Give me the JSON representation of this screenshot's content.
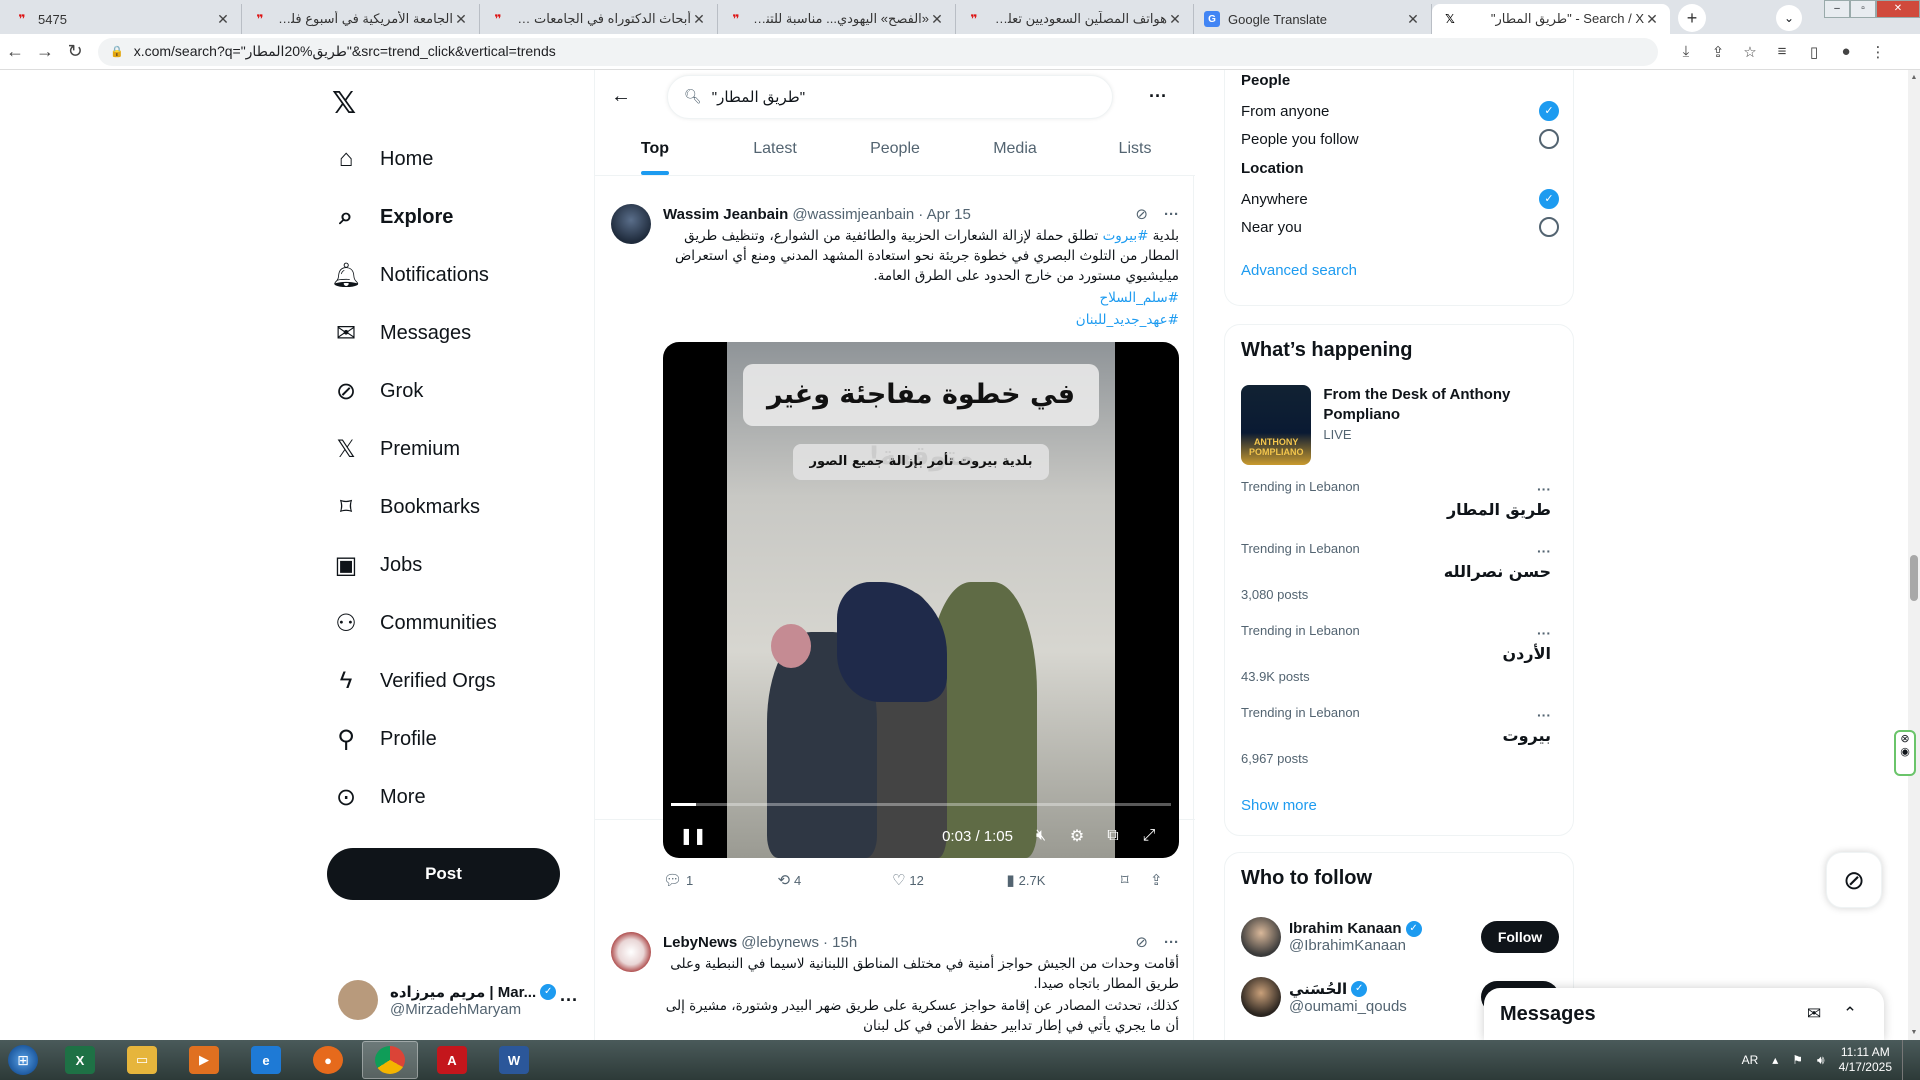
{
  "browser": {
    "tabs": [
      {
        "title": "5475",
        "icon": "red-quote-icon",
        "active": false
      },
      {
        "title": "الجامعة الأمريكية في أسبوع فلسطين: معنوي",
        "icon": "red-quote-icon",
        "active": false
      },
      {
        "title": "أبحاث الدكتوراه في الجامعات الخاصة: من يُ",
        "icon": "red-quote-icon",
        "active": false
      },
      {
        "title": "«الفصح» اليهودي... مناسبة للتنكيل بالفلسط",
        "icon": "red-quote-icon",
        "active": false
      },
      {
        "title": "هواتف المصلّين السعوديين تعلن ولادة المقاو",
        "icon": "red-quote-icon",
        "active": false
      },
      {
        "title": "Google Translate",
        "icon": "google-translate-icon",
        "active": false
      },
      {
        "title": "\"طريق المطار\" - Search / X",
        "icon": "x-logo-icon",
        "active": true
      }
    ],
    "url": "x.com/search?q=\"طريق%20المطار\"&src=trend_click&vertical=trends"
  },
  "nav": {
    "items": [
      {
        "label": "Home",
        "icon": "home-icon"
      },
      {
        "label": "Explore",
        "icon": "search-icon",
        "bold": true
      },
      {
        "label": "Notifications",
        "icon": "bell-icon"
      },
      {
        "label": "Messages",
        "icon": "mail-icon"
      },
      {
        "label": "Grok",
        "icon": "grok-icon"
      },
      {
        "label": "Premium",
        "icon": "x-logo-icon"
      },
      {
        "label": "Bookmarks",
        "icon": "bookmark-icon"
      },
      {
        "label": "Jobs",
        "icon": "briefcase-icon"
      },
      {
        "label": "Communities",
        "icon": "people-icon"
      },
      {
        "label": "Verified Orgs",
        "icon": "lightning-icon"
      },
      {
        "label": "Profile",
        "icon": "person-icon"
      },
      {
        "label": "More",
        "icon": "more-circle-icon"
      }
    ],
    "post_label": "Post",
    "account": {
      "name": "مريم ميرزاده | Mar...",
      "handle": "@MirzadehMaryam"
    }
  },
  "search": {
    "query": "\"طريق المطار\"",
    "tabs": [
      "Top",
      "Latest",
      "People",
      "Media",
      "Lists"
    ],
    "active_tab": "Top"
  },
  "tweets": [
    {
      "name": "Wassim Jeanbain",
      "handle": "@wassimjeanbain",
      "date": "· Apr 15",
      "text_prefix": "بلدية ",
      "text_tag": "#بيروت",
      "text_rest": " تطلق حملة لإزالة الشعارات الحزبية والطائفية من الشوارع، وتنظيف طريق المطار من التلوث البصري في خطوة جريئة نحو استعادة المشهد المدني ومنع أي استعراض ميليشيوي مستورد من خارج الحدود على الطرق العامة.",
      "hashtags": [
        "#سلم_السلاح",
        "#عهد_جديد_للبنان"
      ],
      "video": {
        "overlay_title": "في خطوة مفاجئة وغير متوقعة!",
        "overlay_subtitle": "بلدية بيروت تأمر بإزالة جميع الصور",
        "time": "0:03 / 1:05",
        "progress": 0.05
      },
      "stats": {
        "replies": "1",
        "reposts": "4",
        "likes": "12",
        "views": "2.7K"
      }
    },
    {
      "name": "LebyNews",
      "handle": "@lebynews",
      "date": "· 15h",
      "line1": "أقامت وحدات من الجيش حواجز أمنية في مختلف المناطق اللبنانية لاسيما في النبطية وعلى طريق المطار باتجاه صيدا.",
      "line2": "كذلك، تحدثت المصادر عن إقامة حواجز عسكرية على طريق ضهر البيدر وشتورة، مشيرة إلى أن ما يجري يأتي في إطار تدابير حفظ الأمن في كل لبنان"
    }
  ],
  "filters": {
    "people_title": "People",
    "people_options": [
      {
        "label": "From anyone",
        "selected": true
      },
      {
        "label": "People you follow",
        "selected": false
      }
    ],
    "location_title": "Location",
    "location_options": [
      {
        "label": "Anywhere",
        "selected": true
      },
      {
        "label": "Near you",
        "selected": false
      }
    ],
    "advanced_label": "Advanced search"
  },
  "happening": {
    "title": "What’s happening",
    "promo": {
      "title": "From the Desk of Anthony Pompliano",
      "status": "LIVE",
      "image_text": "ANTHONY POMPLIANO"
    },
    "trends": [
      {
        "category": "Trending in Lebanon",
        "term": "طريق المطار",
        "posts": ""
      },
      {
        "category": "Trending in Lebanon",
        "term": "حسن نصرالله",
        "posts": "3,080 posts"
      },
      {
        "category": "Trending in Lebanon",
        "term": "الأردن",
        "posts": "43.9K posts"
      },
      {
        "category": "Trending in Lebanon",
        "term": "بيروت",
        "posts": "6,967 posts"
      }
    ],
    "show_more": "Show more"
  },
  "who_to_follow": {
    "title": "Who to follow",
    "accounts": [
      {
        "name": "Ibrahim Kanaan",
        "handle": "@IbrahimKanaan",
        "button": "Follow"
      },
      {
        "name": "الحُسَني",
        "handle": "@oumami_qouds",
        "button": "Follow"
      }
    ]
  },
  "messages_drawer": {
    "title": "Messages"
  },
  "taskbar": {
    "apps": [
      "excel",
      "explorer",
      "media",
      "ie",
      "firefox",
      "chrome",
      "acrobat",
      "word"
    ],
    "lang": "AR",
    "time": "11:11 AM",
    "date": "4/17/2025"
  },
  "colors": {
    "accent": "#1d9bf0",
    "text": "#0f1419",
    "muted": "#536471"
  }
}
